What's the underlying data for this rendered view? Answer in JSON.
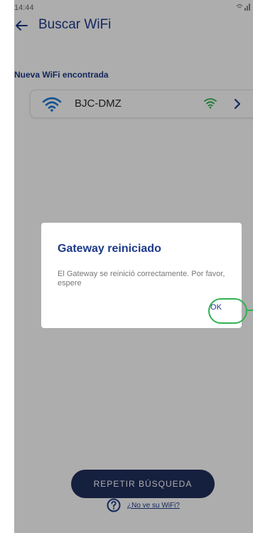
{
  "status_bar": {
    "time": "14:44"
  },
  "app_bar": {
    "title": "Buscar WiFi"
  },
  "section": {
    "label": "Nueva WiFi encontrada"
  },
  "networks": [
    {
      "ssid": "BJC-DMZ"
    }
  ],
  "footer": {
    "repeat_label": "REPETIR BÚSQUEDA",
    "help_link": "¿No ve su WiFi?"
  },
  "dialog": {
    "title": "Gateway reiniciado",
    "message": "El Gateway se reinició correctamente. Por favor, espere",
    "ok_label": "OK"
  },
  "colors": {
    "primary": "#1d3a8a",
    "accent_blue": "#1f7bd8",
    "signal_green": "#2fb34f",
    "button_dark": "#1f2e5c",
    "annotation": "#2fb34f"
  },
  "icons": {
    "back": "arrow-left-icon",
    "wifi": "wifi-icon",
    "signal": "wifi-signal-strength-icon",
    "chevron": "chevron-right-icon",
    "help": "question-circle-icon"
  }
}
